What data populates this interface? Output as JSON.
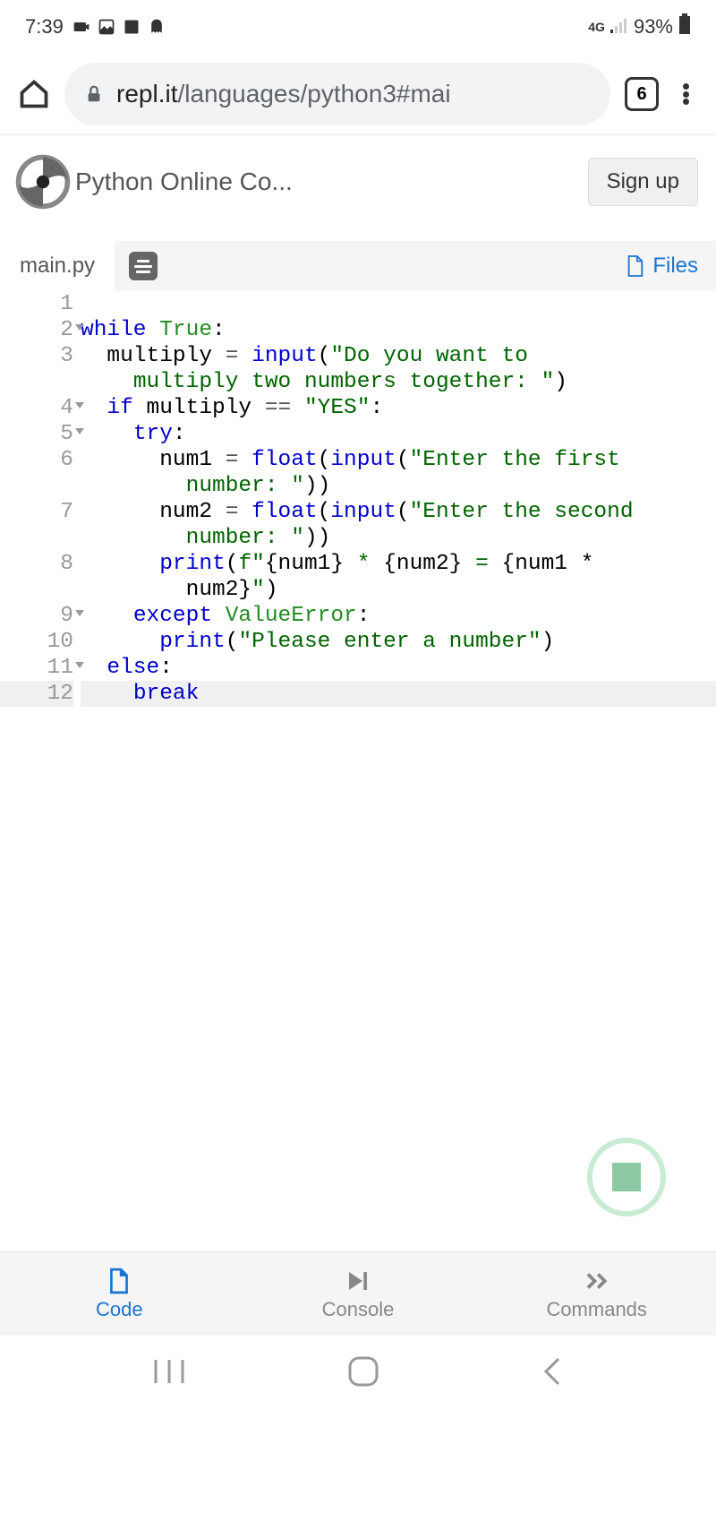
{
  "status": {
    "time": "7:39",
    "battery": "93%",
    "network": "4G"
  },
  "browser": {
    "url_domain": "repl.it",
    "url_path": "/languages/python3#mai",
    "tab_count": "6"
  },
  "replit": {
    "title": "Python Online Co...",
    "sign_up": "Sign up",
    "filename": "main.py",
    "files_btn": "Files"
  },
  "code": {
    "lines": [
      {
        "num": "1",
        "fold": false,
        "text": ""
      },
      {
        "num": "2",
        "fold": true,
        "segments": [
          {
            "t": "while ",
            "c": "kw"
          },
          {
            "t": "True",
            "c": "lit"
          },
          {
            "t": ":",
            "c": ""
          }
        ]
      },
      {
        "num": "3",
        "fold": false,
        "segments": [
          {
            "t": "  multiply ",
            "c": ""
          },
          {
            "t": "=",
            "c": "op"
          },
          {
            "t": " ",
            "c": ""
          },
          {
            "t": "input",
            "c": "fn"
          },
          {
            "t": "(",
            "c": ""
          },
          {
            "t": "\"Do you want to ",
            "c": "str"
          }
        ]
      },
      {
        "num": "",
        "fold": false,
        "segments": [
          {
            "t": "    ",
            "c": ""
          },
          {
            "t": "multiply two numbers together: \"",
            "c": "str"
          },
          {
            "t": ")",
            "c": ""
          }
        ]
      },
      {
        "num": "4",
        "fold": true,
        "segments": [
          {
            "t": "  ",
            "c": ""
          },
          {
            "t": "if",
            "c": "kw"
          },
          {
            "t": " multiply ",
            "c": ""
          },
          {
            "t": "==",
            "c": "op"
          },
          {
            "t": " ",
            "c": ""
          },
          {
            "t": "\"YES\"",
            "c": "str"
          },
          {
            "t": ":",
            "c": ""
          }
        ]
      },
      {
        "num": "5",
        "fold": true,
        "segments": [
          {
            "t": "    ",
            "c": ""
          },
          {
            "t": "try",
            "c": "kw"
          },
          {
            "t": ":",
            "c": ""
          }
        ]
      },
      {
        "num": "6",
        "fold": false,
        "segments": [
          {
            "t": "      num1 ",
            "c": ""
          },
          {
            "t": "=",
            "c": "op"
          },
          {
            "t": " ",
            "c": ""
          },
          {
            "t": "float",
            "c": "fn"
          },
          {
            "t": "(",
            "c": ""
          },
          {
            "t": "input",
            "c": "fn"
          },
          {
            "t": "(",
            "c": ""
          },
          {
            "t": "\"Enter the first ",
            "c": "str"
          }
        ]
      },
      {
        "num": "",
        "fold": false,
        "segments": [
          {
            "t": "        ",
            "c": ""
          },
          {
            "t": "number: \"",
            "c": "str"
          },
          {
            "t": "))",
            "c": ""
          }
        ]
      },
      {
        "num": "7",
        "fold": false,
        "segments": [
          {
            "t": "      num2 ",
            "c": ""
          },
          {
            "t": "=",
            "c": "op"
          },
          {
            "t": " ",
            "c": ""
          },
          {
            "t": "float",
            "c": "fn"
          },
          {
            "t": "(",
            "c": ""
          },
          {
            "t": "input",
            "c": "fn"
          },
          {
            "t": "(",
            "c": ""
          },
          {
            "t": "\"Enter the second ",
            "c": "str"
          }
        ]
      },
      {
        "num": "",
        "fold": false,
        "segments": [
          {
            "t": "        ",
            "c": ""
          },
          {
            "t": "number: \"",
            "c": "str"
          },
          {
            "t": "))",
            "c": ""
          }
        ]
      },
      {
        "num": "8",
        "fold": false,
        "segments": [
          {
            "t": "      ",
            "c": ""
          },
          {
            "t": "print",
            "c": "fn"
          },
          {
            "t": "(",
            "c": ""
          },
          {
            "t": "f\"",
            "c": "str"
          },
          {
            "t": "{num1}",
            "c": ""
          },
          {
            "t": " * ",
            "c": "str"
          },
          {
            "t": "{num2}",
            "c": ""
          },
          {
            "t": " = ",
            "c": "str"
          },
          {
            "t": "{num1 * ",
            "c": ""
          }
        ]
      },
      {
        "num": "",
        "fold": false,
        "segments": [
          {
            "t": "        ",
            "c": ""
          },
          {
            "t": "num2}",
            "c": ""
          },
          {
            "t": "\"",
            "c": "str"
          },
          {
            "t": ")",
            "c": ""
          }
        ]
      },
      {
        "num": "9",
        "fold": true,
        "segments": [
          {
            "t": "    ",
            "c": ""
          },
          {
            "t": "except",
            "c": "kw"
          },
          {
            "t": " ",
            "c": ""
          },
          {
            "t": "ValueError",
            "c": "nm"
          },
          {
            "t": ":",
            "c": ""
          }
        ]
      },
      {
        "num": "10",
        "fold": false,
        "segments": [
          {
            "t": "      ",
            "c": ""
          },
          {
            "t": "print",
            "c": "fn"
          },
          {
            "t": "(",
            "c": ""
          },
          {
            "t": "\"Please enter a number\"",
            "c": "str"
          },
          {
            "t": ")",
            "c": ""
          }
        ]
      },
      {
        "num": "11",
        "fold": true,
        "segments": [
          {
            "t": "  ",
            "c": ""
          },
          {
            "t": "else",
            "c": "kw"
          },
          {
            "t": ":",
            "c": ""
          }
        ]
      },
      {
        "num": "12",
        "fold": false,
        "hl": true,
        "segments": [
          {
            "t": "    ",
            "c": ""
          },
          {
            "t": "break",
            "c": "kw"
          }
        ]
      }
    ]
  },
  "tabs": {
    "code": "Code",
    "console": "Console",
    "commands": "Commands"
  }
}
